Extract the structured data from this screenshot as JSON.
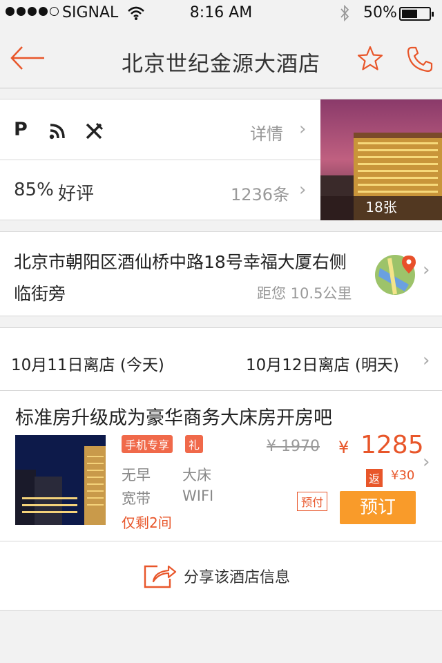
{
  "status_bar": {
    "carrier": "SIGNAL",
    "time": "8:16 AM",
    "battery": "50%"
  },
  "nav": {
    "title": "北京世纪金源大酒店"
  },
  "hotel": {
    "facilities_link": "详情",
    "rating": "85%",
    "rating_label": "好评",
    "review_count": "1236条",
    "photo_count": "18张",
    "address_line1": "北京市朝阳区酒仙桥中路18号幸福大厦右侧",
    "address_line2": "临街旁",
    "distance": "距您 10.5公里"
  },
  "dates": {
    "checkin": "10月11日离店 (今天)",
    "checkout": "10月12日离店 (明天)"
  },
  "room": {
    "title": "标准房升级成为豪华商务大床房开房吧",
    "tag_mobile": "手机专享",
    "tag_gift": "礼",
    "feature1": "无早",
    "feature2": "大床",
    "feature3": "宽带",
    "feature4": "WIFI",
    "remaining": "仅剩2间",
    "original_price": "¥ 1970",
    "currency": "¥",
    "price": "1285",
    "cashback_label": "返",
    "cashback": "¥30",
    "prepay": "预付",
    "book_label": "预订"
  },
  "share": {
    "label": "分享该酒店信息"
  },
  "colors": {
    "accent": "#e8562a",
    "book_button": "#f99b2a",
    "tag": "#f0694a"
  }
}
